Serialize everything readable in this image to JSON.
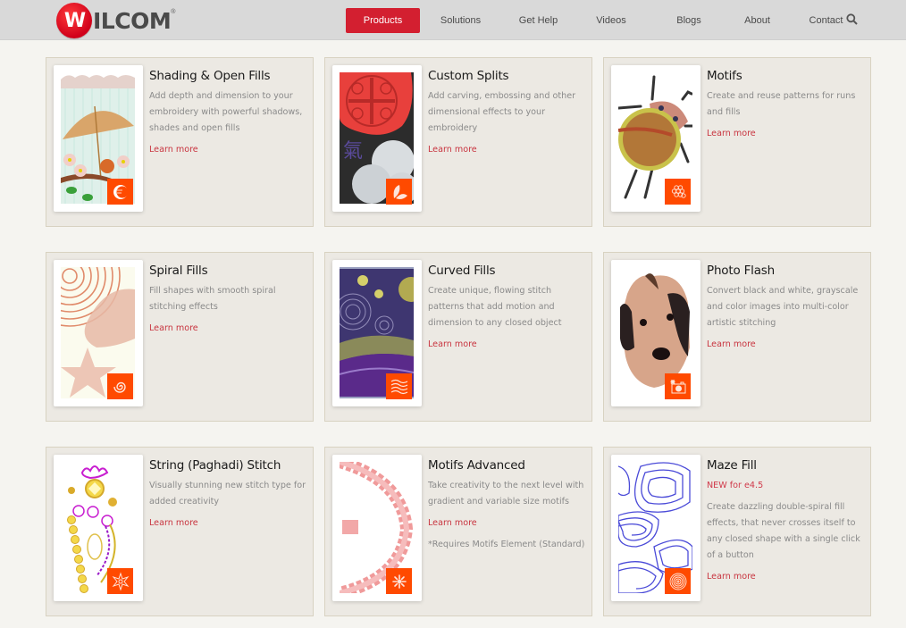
{
  "header": {
    "logo_letter": "W",
    "logo_text": "ILCOM",
    "logo_reg": "®",
    "nav": [
      {
        "label": "Products",
        "active": true
      },
      {
        "label": "Solutions"
      },
      {
        "label": "Get Help"
      },
      {
        "label": "Videos"
      },
      {
        "label": "Blogs"
      },
      {
        "label": "About"
      },
      {
        "label": "Contact"
      }
    ],
    "search_icon": "search-icon"
  },
  "colors": {
    "brand_red": "#d31f30",
    "link_red": "#c8343f",
    "badge_orange": "#ff4a00",
    "card_bg": "#ece9e3",
    "page_bg": "#f5f4f0"
  },
  "features": [
    {
      "title": "Shading & Open Fills",
      "description": "Add depth and dimension to your embroidery with powerful shadows, shades and open fills",
      "link": "Learn more",
      "badge_icon": "shading-icon"
    },
    {
      "title": "Custom Splits",
      "description": "Add carving, embossing and other dimensional effects to your embroidery",
      "link": "Learn more",
      "badge_icon": "leaves-icon"
    },
    {
      "title": "Motifs",
      "description": "Create and reuse patterns for runs and fills",
      "link": "Learn more",
      "badge_icon": "motif-pattern-icon"
    },
    {
      "title": "Spiral Fills",
      "description": "Fill shapes with smooth spiral stitching effects",
      "link": "Learn more",
      "badge_icon": "spiral-icon"
    },
    {
      "title": "Curved Fills",
      "description": "Create unique, flowing stitch patterns that add motion and dimension to any closed object",
      "link": "Learn more",
      "badge_icon": "wave-lines-icon"
    },
    {
      "title": "Photo Flash",
      "description": "Convert black and white, grayscale and color images into multi-color artistic stitching",
      "link": "Learn more",
      "badge_icon": "camera-flash-icon"
    },
    {
      "title": "String (Paghadi) Stitch",
      "description": "Visually stunning new stitch type for added creativity",
      "link": "Learn more",
      "badge_icon": "flower-star-icon"
    },
    {
      "title": "Motifs Advanced",
      "description": "Take creativity to the next level with gradient and variable size motifs",
      "link": "Learn more",
      "note": "*Requires Motifs Element (Standard)",
      "badge_icon": "burst-icon"
    },
    {
      "title": "Maze Fill",
      "new_label": "NEW for e4.5",
      "description": "Create dazzling double-spiral fill effects, that never crosses itself to any closed shape with a single click of a button",
      "link": "Learn more",
      "badge_icon": "maze-icon"
    }
  ]
}
